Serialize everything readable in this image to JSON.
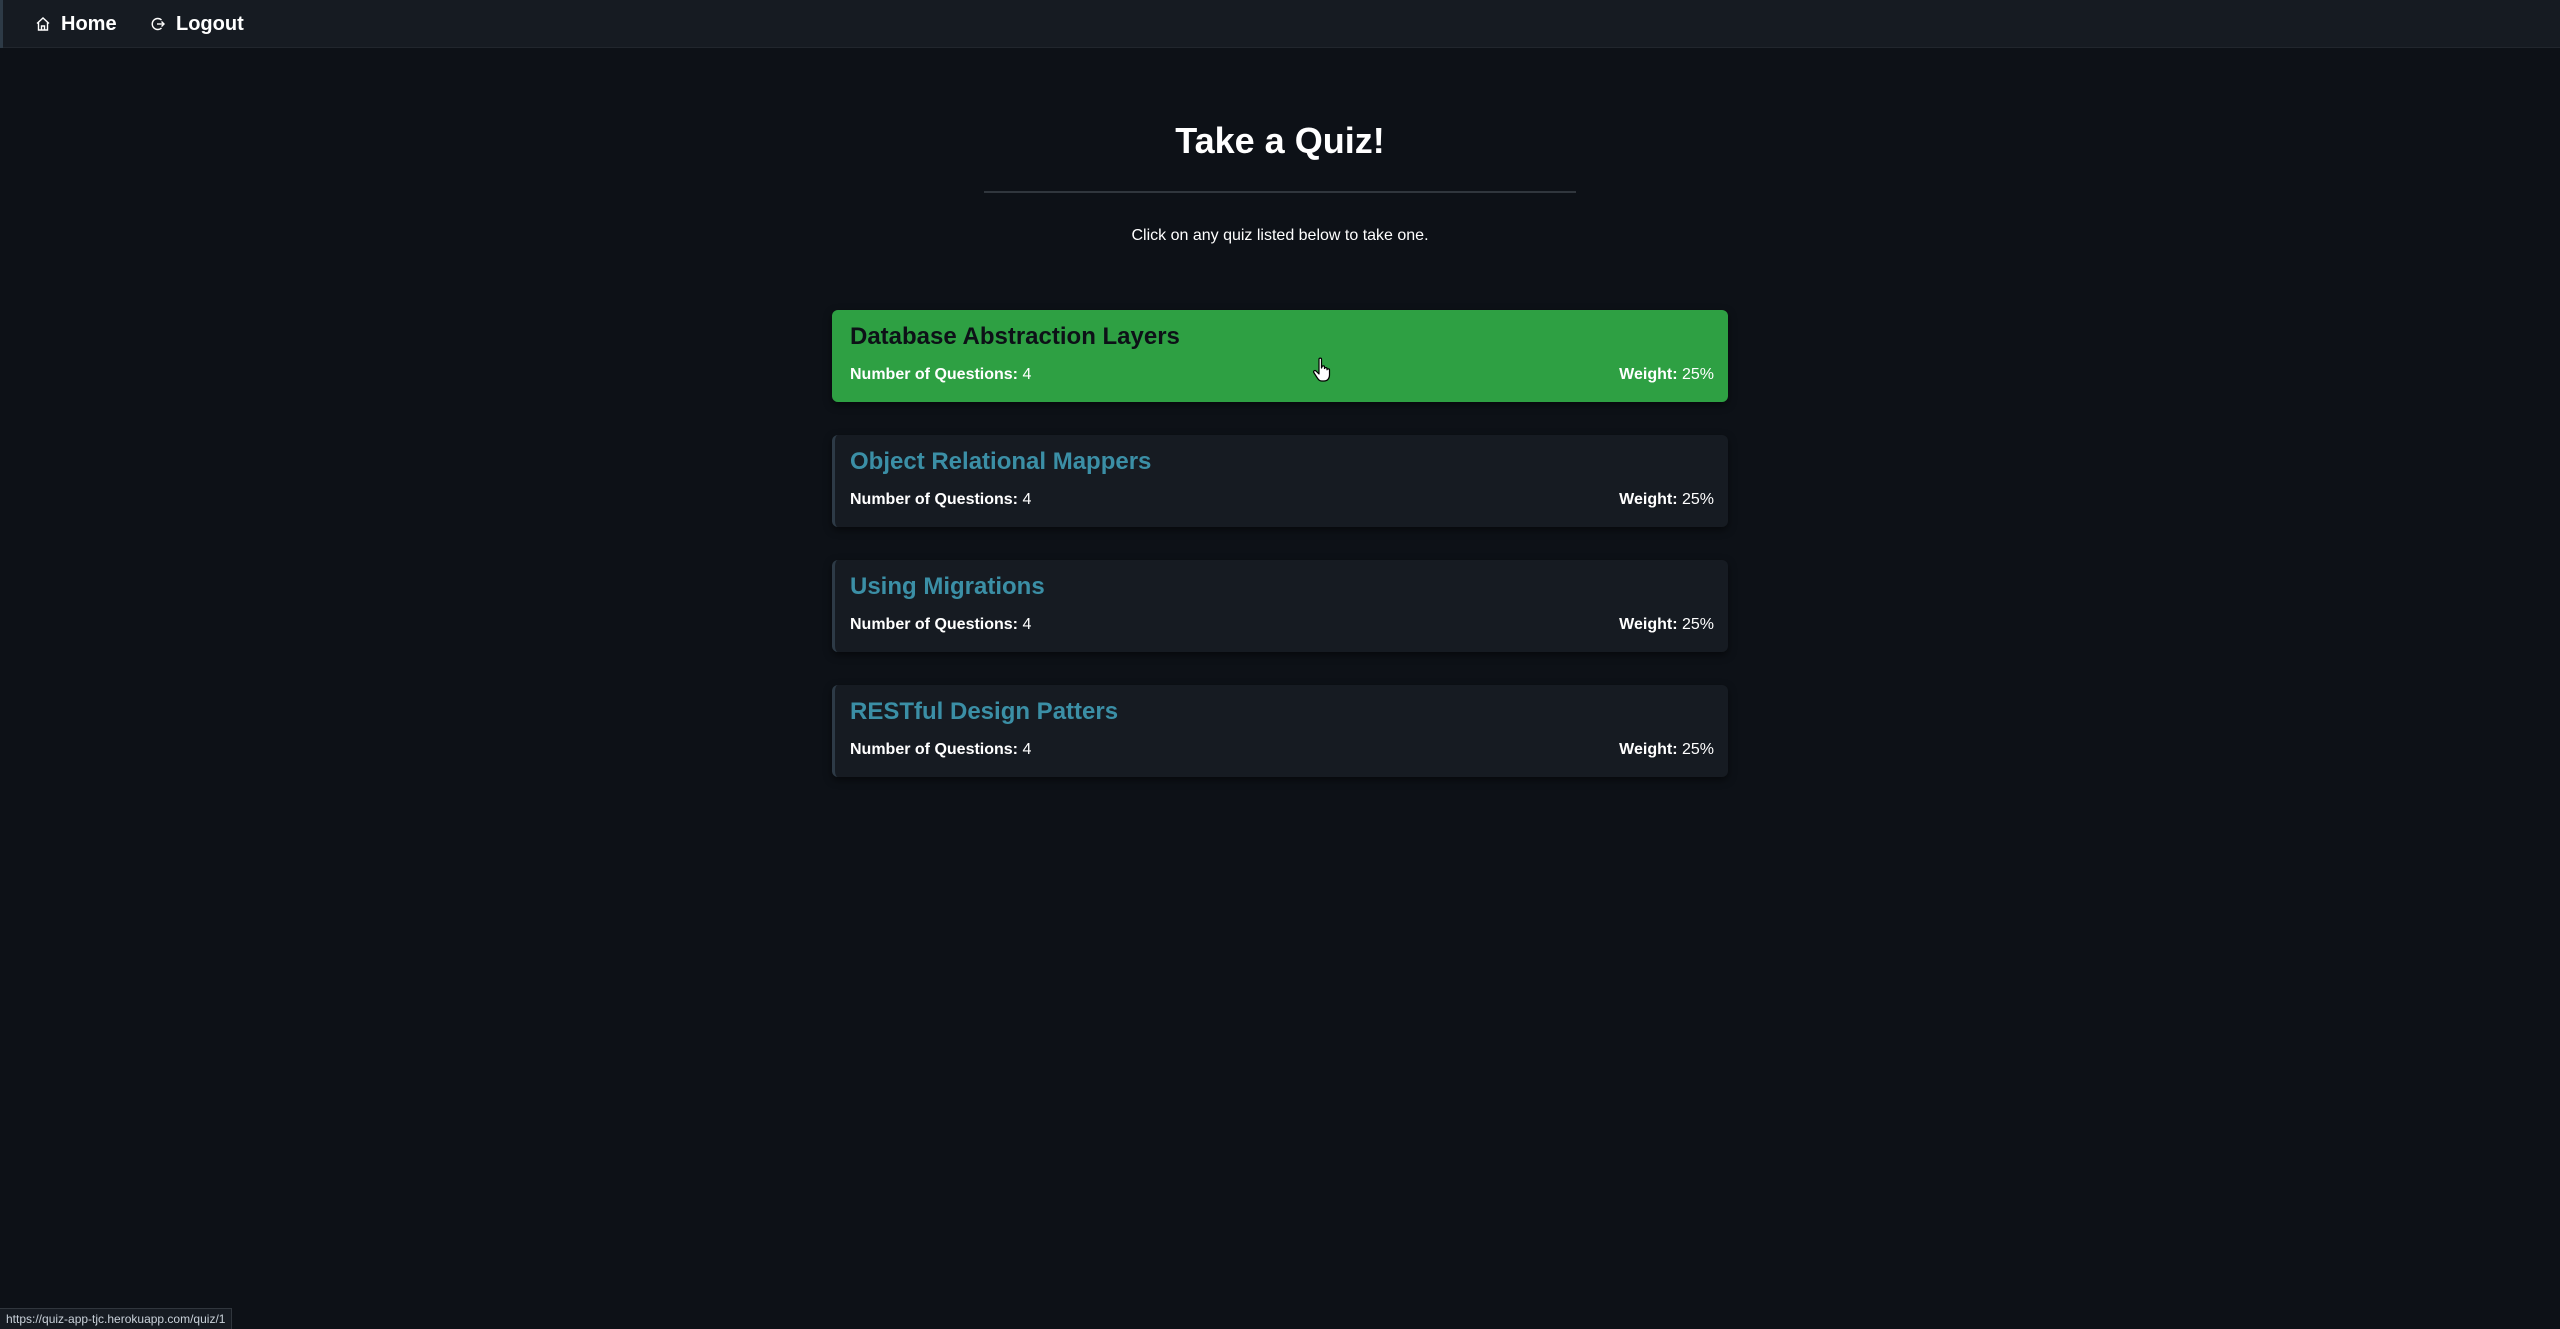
{
  "nav": {
    "home_label": "Home",
    "home_icon": "home-icon",
    "logout_label": "Logout",
    "logout_icon": "logout-icon"
  },
  "page": {
    "title": "Take a Quiz!",
    "subtitle": "Click on any quiz listed below to take one."
  },
  "quizzes": [
    {
      "title": "Database Abstraction Layers",
      "questions_label": "Number of Questions:",
      "questions": "4",
      "weight_label": "Weight:",
      "weight": "25%",
      "hovered": true
    },
    {
      "title": "Object Relational Mappers",
      "questions_label": "Number of Questions:",
      "questions": "4",
      "weight_label": "Weight:",
      "weight": "25%",
      "hovered": false
    },
    {
      "title": "Using Migrations",
      "questions_label": "Number of Questions:",
      "questions": "4",
      "weight_label": "Weight:",
      "weight": "25%",
      "hovered": false
    },
    {
      "title": "RESTful Design Patters",
      "questions_label": "Number of Questions:",
      "questions": "4",
      "weight_label": "Weight:",
      "weight": "25%",
      "hovered": false
    }
  ],
  "status_bar": {
    "url": "https://quiz-app-tjc.herokuapp.com/quiz/1"
  },
  "colors": {
    "background": "#0d1117",
    "card": "#161b22",
    "card_hover": "#2ea043",
    "quiz_title": "#3b8fa6"
  }
}
